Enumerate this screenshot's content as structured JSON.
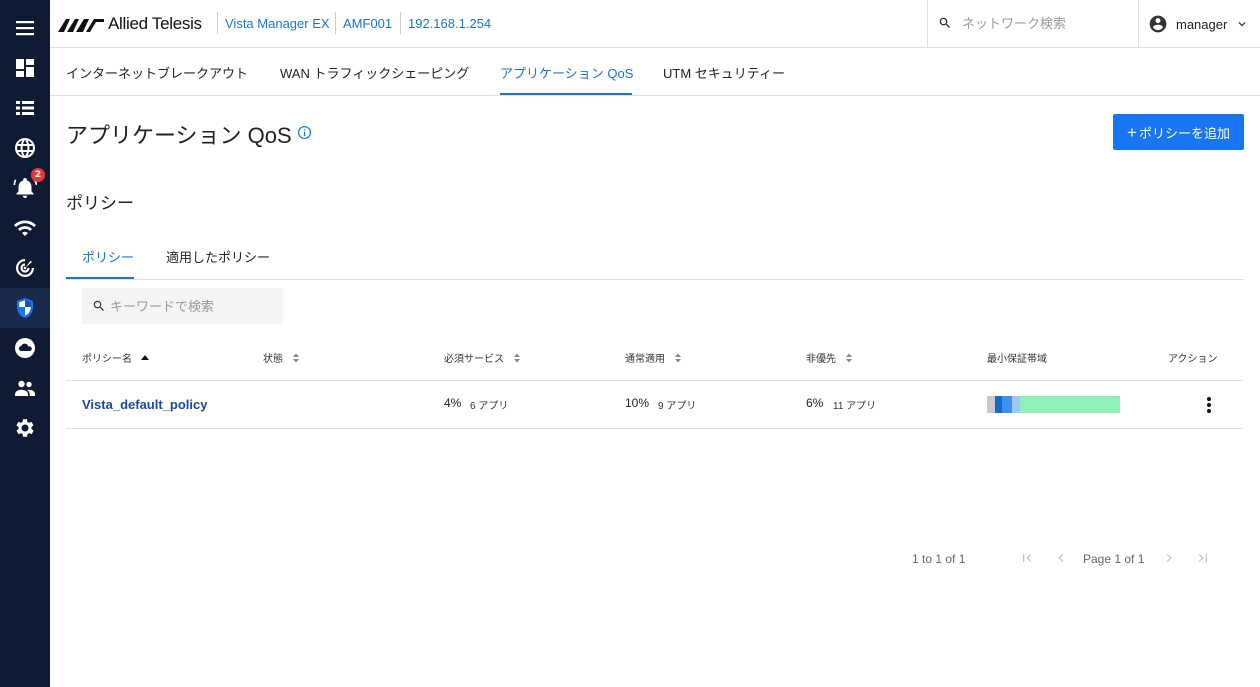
{
  "rail": {
    "items": [
      {
        "name": "menu-icon"
      },
      {
        "name": "dashboard-icon"
      },
      {
        "name": "list-icon"
      },
      {
        "name": "globe-icon"
      },
      {
        "name": "bell-icon",
        "badge": "2"
      },
      {
        "name": "wifi-icon"
      },
      {
        "name": "radar-icon"
      },
      {
        "name": "shield-icon",
        "active": true
      },
      {
        "name": "cloud-icon"
      },
      {
        "name": "users-icon"
      },
      {
        "name": "gear-icon"
      }
    ]
  },
  "header": {
    "logo_text": "Allied Telesis",
    "breadcrumbs": [
      "Vista Manager EX",
      "AMF001",
      "192.168.1.254"
    ],
    "search_placeholder": "ネットワーク検索",
    "user_name": "manager"
  },
  "main_tabs": [
    {
      "label": "インターネットブレークアウト",
      "active": false
    },
    {
      "label": "WAN トラフィックシェーピング",
      "active": false
    },
    {
      "label": "アプリケーション QoS",
      "active": true
    },
    {
      "label": "UTM セキュリティー",
      "active": false
    }
  ],
  "page": {
    "title": "アプリケーション QoS",
    "add_button_label": "ポリシーを追加",
    "section_title": "ポリシー",
    "sub_tabs": [
      {
        "label": "ポリシー",
        "active": true
      },
      {
        "label": "適用したポリシー",
        "active": false
      }
    ],
    "keyword_placeholder": "キーワードで検索"
  },
  "table": {
    "columns": [
      "ポリシー名",
      "状態",
      "必須サービス",
      "通常適用",
      "非優先",
      "最小保証帯域",
      "アクション"
    ],
    "rows": [
      {
        "name": "Vista_default_policy",
        "status": "",
        "essential_pct": "4%",
        "essential_apps": "6 アプリ",
        "normal_pct": "10%",
        "normal_apps": "9 アプリ",
        "low_pct": "6%",
        "low_apps": "11 アプリ",
        "bandwidth_segments": [
          {
            "color": "#c5cad3",
            "fraction": 0.06
          },
          {
            "color": "#1769c8",
            "fraction": 0.05
          },
          {
            "color": "#3d8ef5",
            "fraction": 0.08
          },
          {
            "color": "#9cc8f7",
            "fraction": 0.06
          },
          {
            "color": "#8ef2b8",
            "fraction": 0.75
          }
        ]
      }
    ]
  },
  "pagination": {
    "summary": "1 to 1 of 1",
    "page_label": "Page 1 of 1"
  },
  "colors": {
    "accent": "#1976d2",
    "button": "#1976f2",
    "rail_bg": "#0f1b33",
    "badge": "#e53935"
  }
}
